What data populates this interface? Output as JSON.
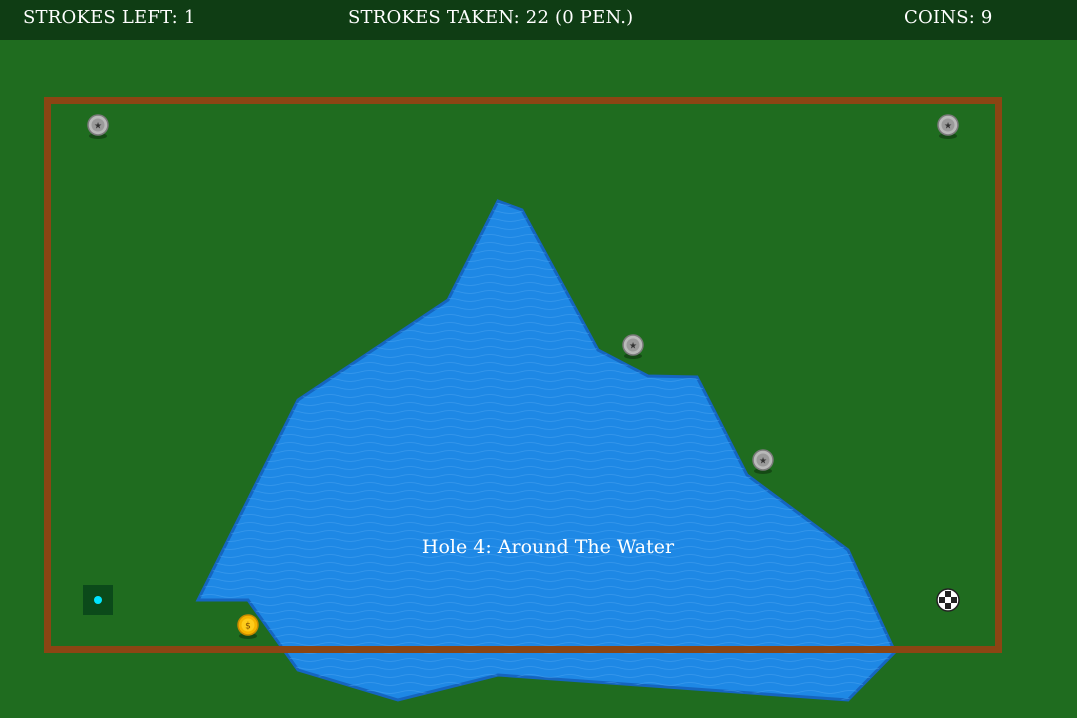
{
  "hud": {
    "strokes_left": "STROKES LEFT: 1",
    "strokes_taken": "STROKES TAKEN: 22 (0 PEN.)",
    "coins": "COINS: 9"
  },
  "hole": {
    "title": "Hole 4: Around The Water"
  },
  "coins": {
    "gold_symbol": "$",
    "silver_symbol": "★"
  },
  "colors": {
    "grass": "#1f6c1f",
    "hud_bar": "#0f3d14",
    "boundary": "#8b4513",
    "water": "#1e88e5",
    "water_edge": "#1565c0",
    "tee_box": "#0b4a1a",
    "ball": "#00e5ff",
    "gold_coin": "#f5b400",
    "silver_coin": "#b9b9b9"
  }
}
